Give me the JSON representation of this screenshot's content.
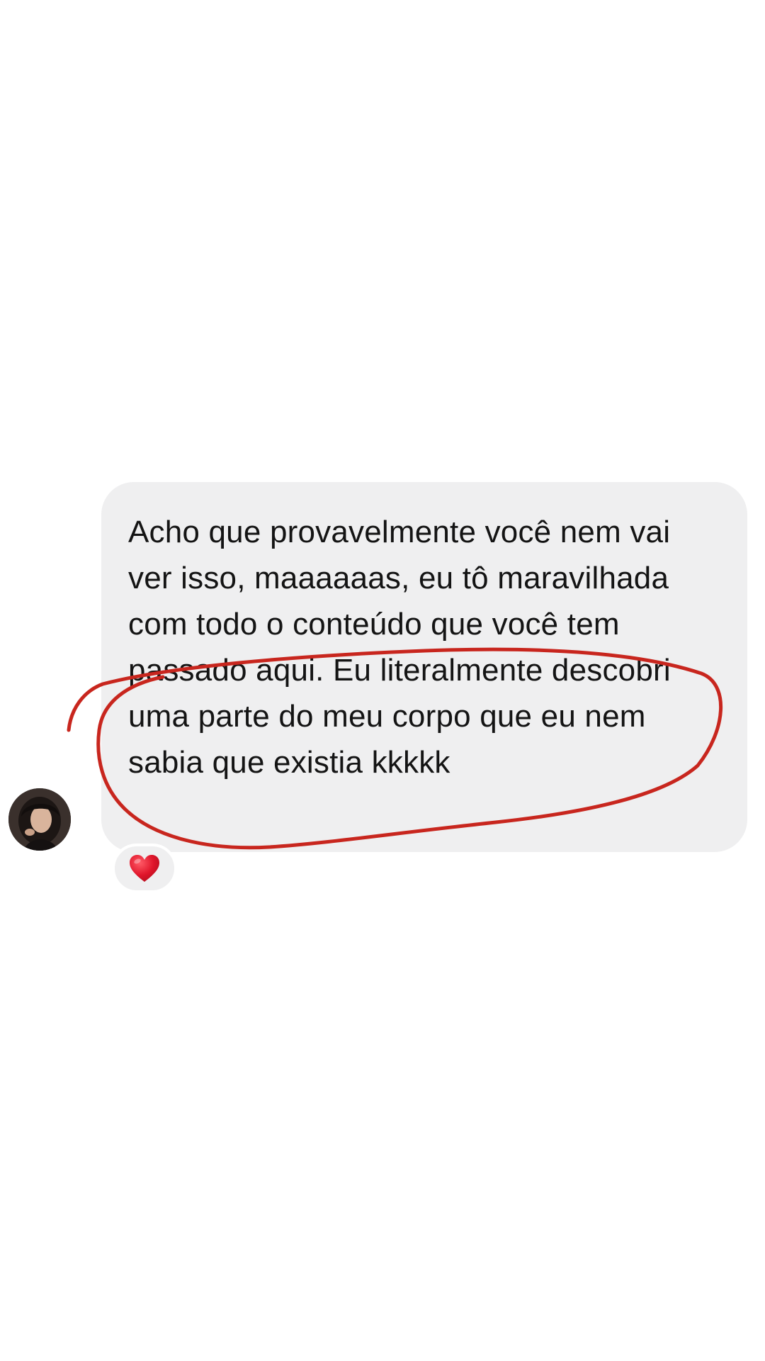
{
  "message": {
    "text": "Acho que provavelmente você nem vai ver isso, maaaaaas, eu tô maravilhada com todo o conteúdo que você tem passado aqui. Eu literalmente descobri uma parte do meu corpo que eu nem sabia que existia kkkkk",
    "bubble_color": "#efeff0",
    "text_color": "#141414"
  },
  "sender": {
    "avatar_icon": "profile-photo"
  },
  "reaction": {
    "icon": "heart-icon",
    "color": "#e0162b"
  },
  "annotation": {
    "type": "hand-drawn-circle",
    "color": "#c8261e"
  }
}
